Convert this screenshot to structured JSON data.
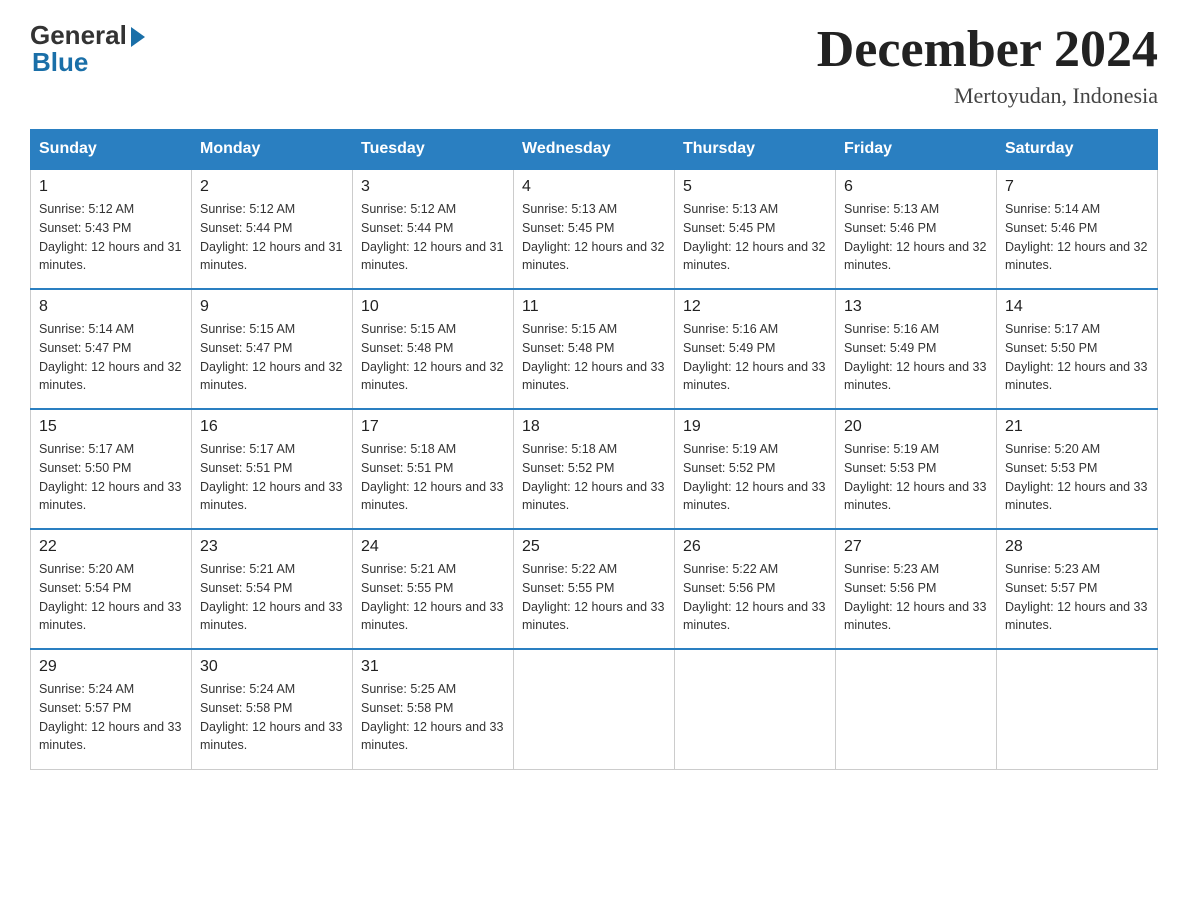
{
  "logo": {
    "general_text": "General",
    "blue_text": "Blue"
  },
  "title": {
    "month_year": "December 2024",
    "location": "Mertoyudan, Indonesia"
  },
  "header_days": [
    "Sunday",
    "Monday",
    "Tuesday",
    "Wednesday",
    "Thursday",
    "Friday",
    "Saturday"
  ],
  "weeks": [
    [
      {
        "day": "1",
        "sunrise": "Sunrise: 5:12 AM",
        "sunset": "Sunset: 5:43 PM",
        "daylight": "Daylight: 12 hours and 31 minutes."
      },
      {
        "day": "2",
        "sunrise": "Sunrise: 5:12 AM",
        "sunset": "Sunset: 5:44 PM",
        "daylight": "Daylight: 12 hours and 31 minutes."
      },
      {
        "day": "3",
        "sunrise": "Sunrise: 5:12 AM",
        "sunset": "Sunset: 5:44 PM",
        "daylight": "Daylight: 12 hours and 31 minutes."
      },
      {
        "day": "4",
        "sunrise": "Sunrise: 5:13 AM",
        "sunset": "Sunset: 5:45 PM",
        "daylight": "Daylight: 12 hours and 32 minutes."
      },
      {
        "day": "5",
        "sunrise": "Sunrise: 5:13 AM",
        "sunset": "Sunset: 5:45 PM",
        "daylight": "Daylight: 12 hours and 32 minutes."
      },
      {
        "day": "6",
        "sunrise": "Sunrise: 5:13 AM",
        "sunset": "Sunset: 5:46 PM",
        "daylight": "Daylight: 12 hours and 32 minutes."
      },
      {
        "day": "7",
        "sunrise": "Sunrise: 5:14 AM",
        "sunset": "Sunset: 5:46 PM",
        "daylight": "Daylight: 12 hours and 32 minutes."
      }
    ],
    [
      {
        "day": "8",
        "sunrise": "Sunrise: 5:14 AM",
        "sunset": "Sunset: 5:47 PM",
        "daylight": "Daylight: 12 hours and 32 minutes."
      },
      {
        "day": "9",
        "sunrise": "Sunrise: 5:15 AM",
        "sunset": "Sunset: 5:47 PM",
        "daylight": "Daylight: 12 hours and 32 minutes."
      },
      {
        "day": "10",
        "sunrise": "Sunrise: 5:15 AM",
        "sunset": "Sunset: 5:48 PM",
        "daylight": "Daylight: 12 hours and 32 minutes."
      },
      {
        "day": "11",
        "sunrise": "Sunrise: 5:15 AM",
        "sunset": "Sunset: 5:48 PM",
        "daylight": "Daylight: 12 hours and 33 minutes."
      },
      {
        "day": "12",
        "sunrise": "Sunrise: 5:16 AM",
        "sunset": "Sunset: 5:49 PM",
        "daylight": "Daylight: 12 hours and 33 minutes."
      },
      {
        "day": "13",
        "sunrise": "Sunrise: 5:16 AM",
        "sunset": "Sunset: 5:49 PM",
        "daylight": "Daylight: 12 hours and 33 minutes."
      },
      {
        "day": "14",
        "sunrise": "Sunrise: 5:17 AM",
        "sunset": "Sunset: 5:50 PM",
        "daylight": "Daylight: 12 hours and 33 minutes."
      }
    ],
    [
      {
        "day": "15",
        "sunrise": "Sunrise: 5:17 AM",
        "sunset": "Sunset: 5:50 PM",
        "daylight": "Daylight: 12 hours and 33 minutes."
      },
      {
        "day": "16",
        "sunrise": "Sunrise: 5:17 AM",
        "sunset": "Sunset: 5:51 PM",
        "daylight": "Daylight: 12 hours and 33 minutes."
      },
      {
        "day": "17",
        "sunrise": "Sunrise: 5:18 AM",
        "sunset": "Sunset: 5:51 PM",
        "daylight": "Daylight: 12 hours and 33 minutes."
      },
      {
        "day": "18",
        "sunrise": "Sunrise: 5:18 AM",
        "sunset": "Sunset: 5:52 PM",
        "daylight": "Daylight: 12 hours and 33 minutes."
      },
      {
        "day": "19",
        "sunrise": "Sunrise: 5:19 AM",
        "sunset": "Sunset: 5:52 PM",
        "daylight": "Daylight: 12 hours and 33 minutes."
      },
      {
        "day": "20",
        "sunrise": "Sunrise: 5:19 AM",
        "sunset": "Sunset: 5:53 PM",
        "daylight": "Daylight: 12 hours and 33 minutes."
      },
      {
        "day": "21",
        "sunrise": "Sunrise: 5:20 AM",
        "sunset": "Sunset: 5:53 PM",
        "daylight": "Daylight: 12 hours and 33 minutes."
      }
    ],
    [
      {
        "day": "22",
        "sunrise": "Sunrise: 5:20 AM",
        "sunset": "Sunset: 5:54 PM",
        "daylight": "Daylight: 12 hours and 33 minutes."
      },
      {
        "day": "23",
        "sunrise": "Sunrise: 5:21 AM",
        "sunset": "Sunset: 5:54 PM",
        "daylight": "Daylight: 12 hours and 33 minutes."
      },
      {
        "day": "24",
        "sunrise": "Sunrise: 5:21 AM",
        "sunset": "Sunset: 5:55 PM",
        "daylight": "Daylight: 12 hours and 33 minutes."
      },
      {
        "day": "25",
        "sunrise": "Sunrise: 5:22 AM",
        "sunset": "Sunset: 5:55 PM",
        "daylight": "Daylight: 12 hours and 33 minutes."
      },
      {
        "day": "26",
        "sunrise": "Sunrise: 5:22 AM",
        "sunset": "Sunset: 5:56 PM",
        "daylight": "Daylight: 12 hours and 33 minutes."
      },
      {
        "day": "27",
        "sunrise": "Sunrise: 5:23 AM",
        "sunset": "Sunset: 5:56 PM",
        "daylight": "Daylight: 12 hours and 33 minutes."
      },
      {
        "day": "28",
        "sunrise": "Sunrise: 5:23 AM",
        "sunset": "Sunset: 5:57 PM",
        "daylight": "Daylight: 12 hours and 33 minutes."
      }
    ],
    [
      {
        "day": "29",
        "sunrise": "Sunrise: 5:24 AM",
        "sunset": "Sunset: 5:57 PM",
        "daylight": "Daylight: 12 hours and 33 minutes."
      },
      {
        "day": "30",
        "sunrise": "Sunrise: 5:24 AM",
        "sunset": "Sunset: 5:58 PM",
        "daylight": "Daylight: 12 hours and 33 minutes."
      },
      {
        "day": "31",
        "sunrise": "Sunrise: 5:25 AM",
        "sunset": "Sunset: 5:58 PM",
        "daylight": "Daylight: 12 hours and 33 minutes."
      },
      null,
      null,
      null,
      null
    ]
  ]
}
